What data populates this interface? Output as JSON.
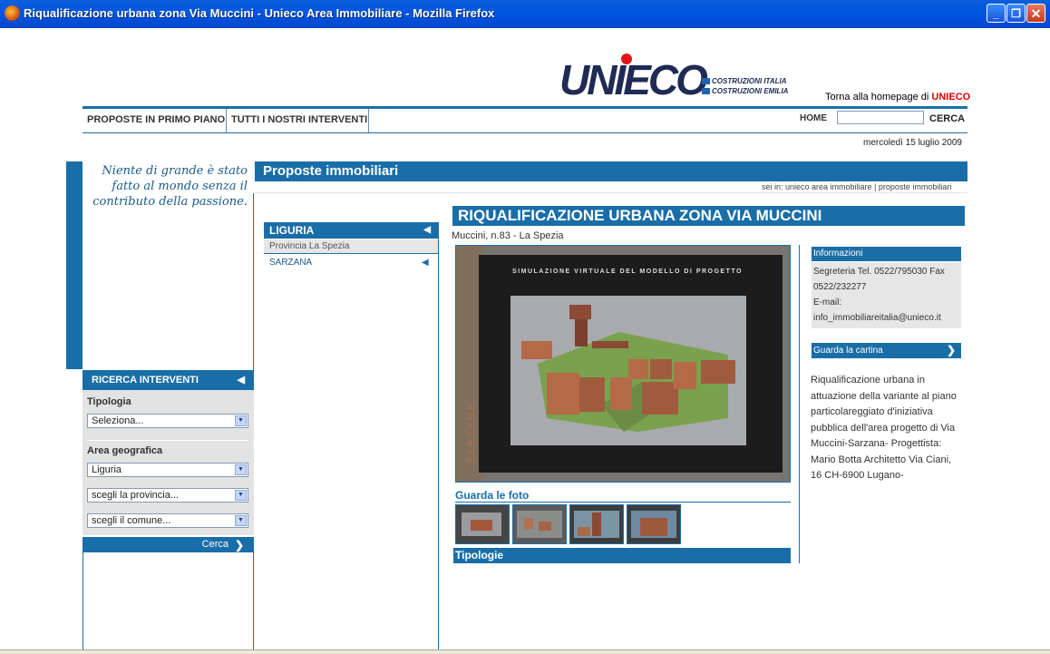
{
  "window": {
    "title": "Riqualificazione urbana zona Via Muccini - Unieco Area Immobiliare - Mozilla Firefox",
    "minimize_icon": "minimize-icon",
    "maximize_icon": "restore-icon",
    "close_icon": "close-icon"
  },
  "header": {
    "logo_text": "UNIECO",
    "logo_sub1": "COSTRUZIONI ITALIA",
    "logo_sub2": "COSTRUZIONI EMILIA",
    "homepage_prefix": "Torna alla homepage di ",
    "homepage_brand": "UNIECO",
    "brand_color": "#d00000"
  },
  "nav": {
    "items": [
      "PROPOSTE IN PRIMO PIANO",
      "TUTTI I NOSTRI INTERVENTI"
    ],
    "home_label": "HOME",
    "search_value": "",
    "search_button": "CERCA"
  },
  "date": "mercoledì 15 luglio 2009",
  "quote": "Niente di grande è stato fatto al mondo senza il contributo della passione.",
  "search_panel": {
    "title": "RICERCA INTERVENTI",
    "tipologia_label": "Tipologia",
    "tipologia_value": "Seleziona...",
    "area_label": "Area geografica",
    "region_value": "Liguria",
    "province_value": "scegli la provincia...",
    "comune_value": "scegli il comune...",
    "submit_label": "Cerca"
  },
  "main": {
    "title": "Proposte immobiliari",
    "breadcrumb": "sei in: unieco area immobiliare | proposte immobiliari"
  },
  "region_panel": {
    "region": "LIGURIA",
    "province": "Provincia La Spezia",
    "town": "SARZANA"
  },
  "project": {
    "title": "RIQUALIFICAZIONE URBANA ZONA VIA MUCCINI",
    "address": "Muccini, n.83 - La Spezia",
    "image_caption": "SIMULAZIONE VIRTUALE DEL MODELLO DI PROGETTO",
    "image_side_text": "SARZANA",
    "photos_label": "Guarda le foto",
    "thumbnail_count": 4,
    "tipologie_label": "Tipologie"
  },
  "info": {
    "title": "Informazioni",
    "line1": "Segreteria Tel. 0522/795030 Fax",
    "line2": "0522/232277",
    "line3": "E-mail:",
    "line4": "info_immobiliareitalia@unieco.it",
    "map_link": "Guarda la cartina",
    "description": "Riqualificazione urbana in attuazione della variante al piano particolareggiato d'iniziativa pubblica dell'area progetto di Via Muccini-Sarzana- Progettista: Mario Botta Architetto Via Ciani, 16 CH-6900 Lugano-"
  },
  "colors": {
    "accent": "#1a6ea8",
    "titlebar": "#0055e5",
    "panel_gray": "#e3e3e3"
  }
}
